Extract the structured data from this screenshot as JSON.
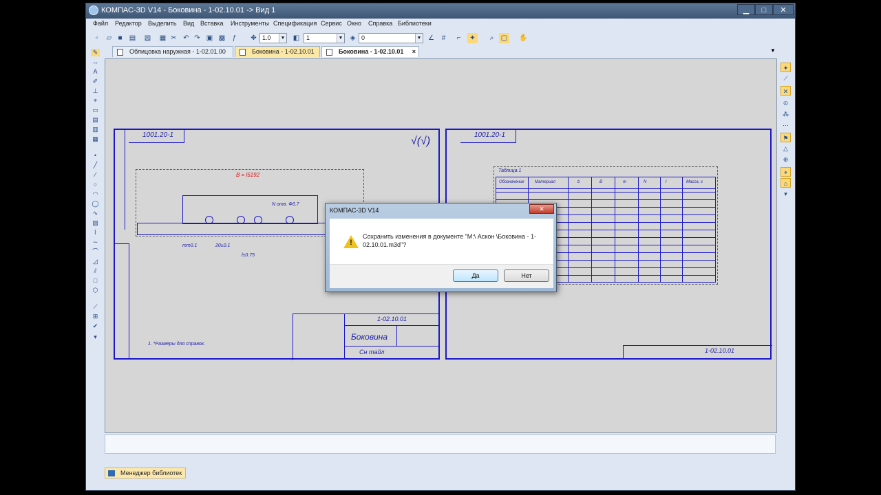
{
  "window": {
    "title": "КОМПАС-3D V14 - Боковина - 1-02.10.01 -> Вид 1",
    "controls": {
      "minimize": "▁",
      "maximize": "□",
      "close": "✕"
    }
  },
  "menu": [
    "Файл",
    "Редактор",
    "Выделить",
    "Вид",
    "Вставка",
    "Инструменты",
    "Спецификация",
    "Сервис",
    "Окно",
    "Справка",
    "Библиотеки"
  ],
  "toolbar": {
    "scale_value": "1.0",
    "layer_value": "1",
    "step_value": "0"
  },
  "tabs": [
    {
      "label": "Облицовка наружная - 1-02.01.00"
    },
    {
      "label": "Боковина - 1-02.10.01"
    },
    {
      "label": "Боковина - 1-02.10.01",
      "close": "×"
    }
  ],
  "drawing": {
    "stamp_code": "1-02.10.01",
    "sheet_title": "Боковина",
    "material_text": "Сн тайл",
    "note": "1. *Размеры для справок.",
    "table_title": "Таблица 1",
    "table_headers": [
      "Обозначение",
      "Материал",
      "b",
      "B",
      "m",
      "N",
      "l",
      "Масса, г"
    ],
    "dim_b": "B = l5192",
    "dim_mm": "mm0.1",
    "dim_20": "20±0.1",
    "dim_l": "l±0.75",
    "note_n": "N отв. Ф6.7"
  },
  "dialog": {
    "title": "КОМПАС-3D V14",
    "close": "✕",
    "icon": "warning-icon",
    "message": "Сохранить изменения в документе \"M:\\ Аскон \\Боковина - 1-02.10.01.m3d\"?",
    "yes": "Да",
    "no": "Нет"
  },
  "library_manager": "Менеджер библиотек"
}
